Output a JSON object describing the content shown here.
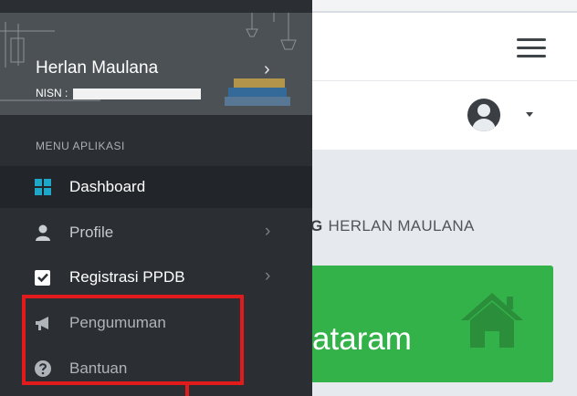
{
  "user": {
    "name": "Herlan Maulana",
    "nisn_label": "NISN : "
  },
  "sidebar": {
    "section_header": "MENU APLIKASI",
    "items": [
      {
        "label": "Dashboard",
        "icon": "dashboard-grid-icon",
        "active": true
      },
      {
        "label": "Profile",
        "icon": "user-icon",
        "has_submenu": true
      },
      {
        "label": "Registrasi PPDB",
        "icon": "check-square-icon",
        "has_submenu": true
      },
      {
        "label": "Pengumuman",
        "icon": "megaphone-icon"
      },
      {
        "label": "Bantuan",
        "icon": "question-circle-icon"
      }
    ]
  },
  "main": {
    "welcome_prefix": "G",
    "welcome_name": "HERLAN MAULANA",
    "card_text": "ataram"
  },
  "colors": {
    "sidebar_bg": "#2b2f33",
    "card_green": "#33b24a",
    "highlight_red": "#e11b1b",
    "dashboard_icon": "#1ea7c8"
  }
}
